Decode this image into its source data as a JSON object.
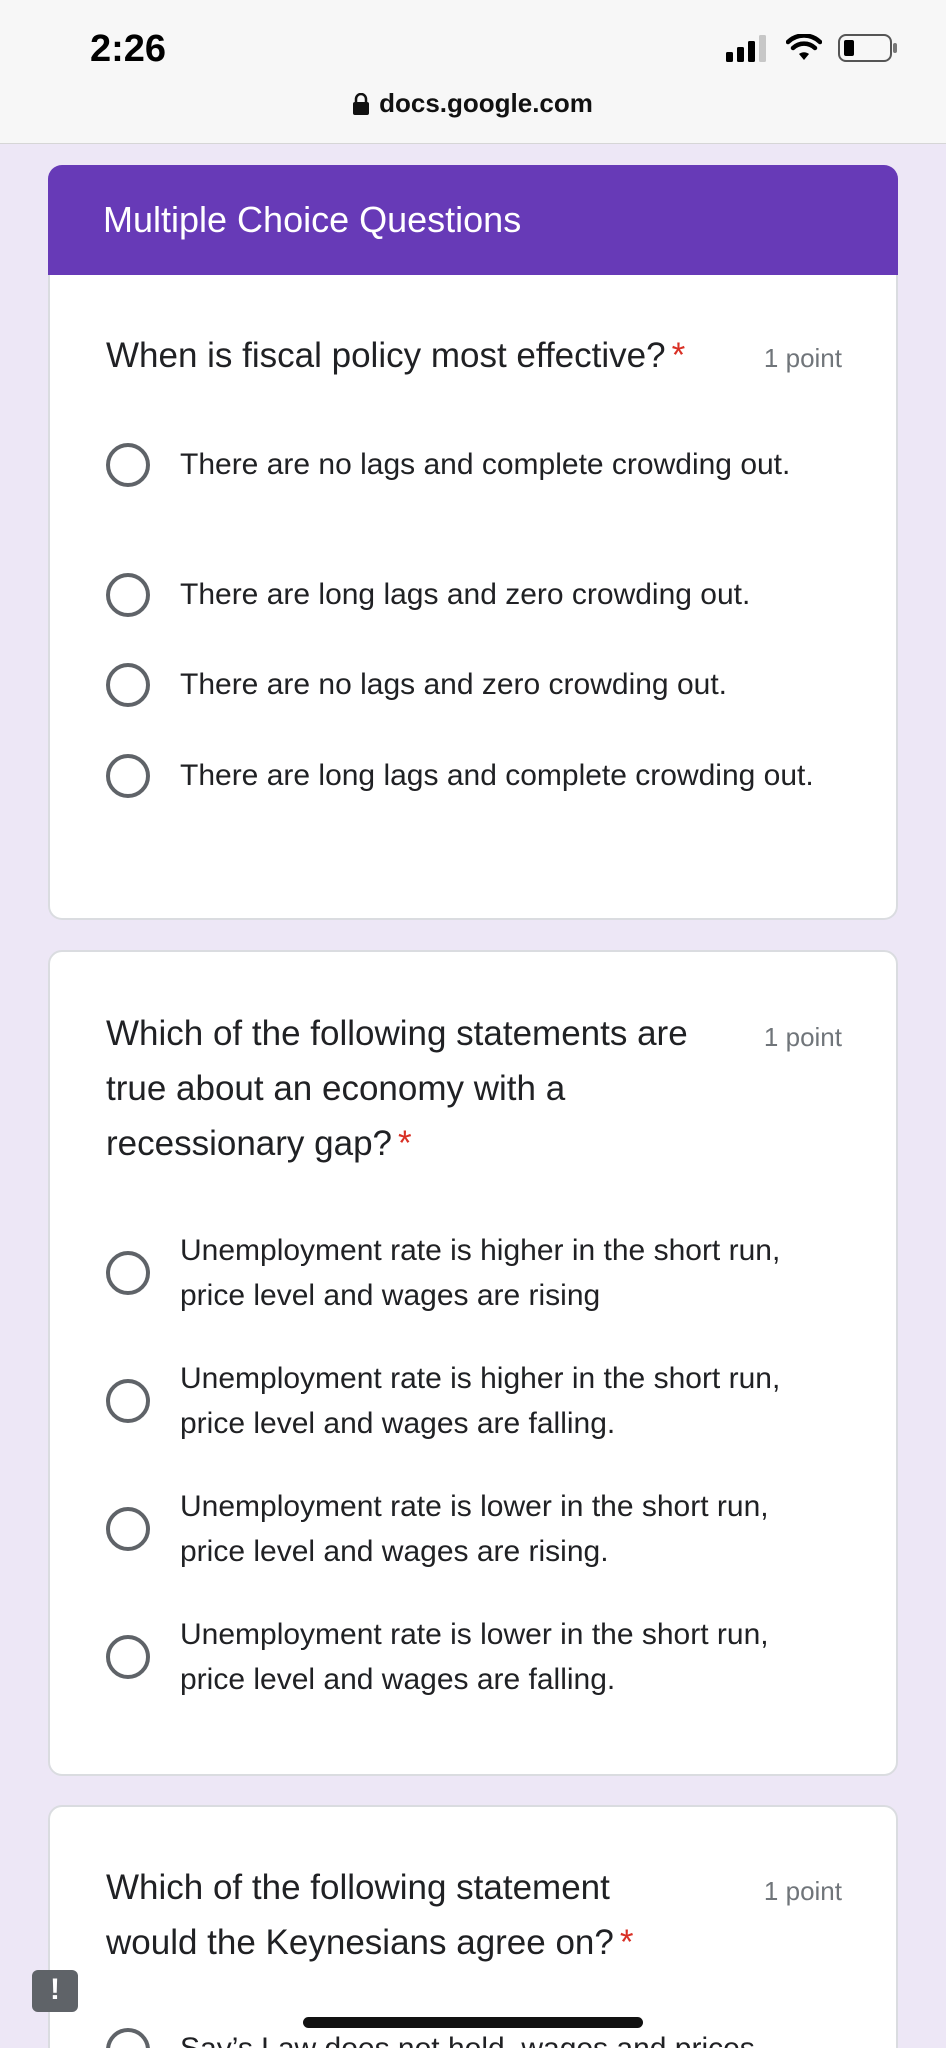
{
  "status_bar": {
    "time": "2:26",
    "url": "docs.google.com"
  },
  "form": {
    "section_title": "Multiple Choice Questions"
  },
  "questions": [
    {
      "text": "When is fiscal policy most effective?",
      "points": "1 point",
      "required_mark": "*",
      "options": [
        "There are no lags and complete crowding out.",
        "There are long lags and zero crowding out.",
        "There are no lags and zero crowding out.",
        "There are long lags and complete crowding out."
      ]
    },
    {
      "text": "Which of the following statements are true about an economy with a recessionary gap?",
      "points": "1 point",
      "required_mark": "*",
      "options": [
        "Unemployment rate is higher in the short run, price level and wages are rising",
        "Unemployment rate is higher in the short run, price level and wages are falling.",
        "Unemployment rate is lower in the short run, price level and wages are rising.",
        "Unemployment rate is lower in the short run, price level and wages are falling."
      ]
    },
    {
      "text": "Which of the following statement would the Keynesians agree on?",
      "points": "1 point",
      "required_mark": "*",
      "options": [
        "Say’s Law does not hold, wages and prices"
      ]
    }
  ],
  "feedback_button": {
    "label": "!"
  }
}
